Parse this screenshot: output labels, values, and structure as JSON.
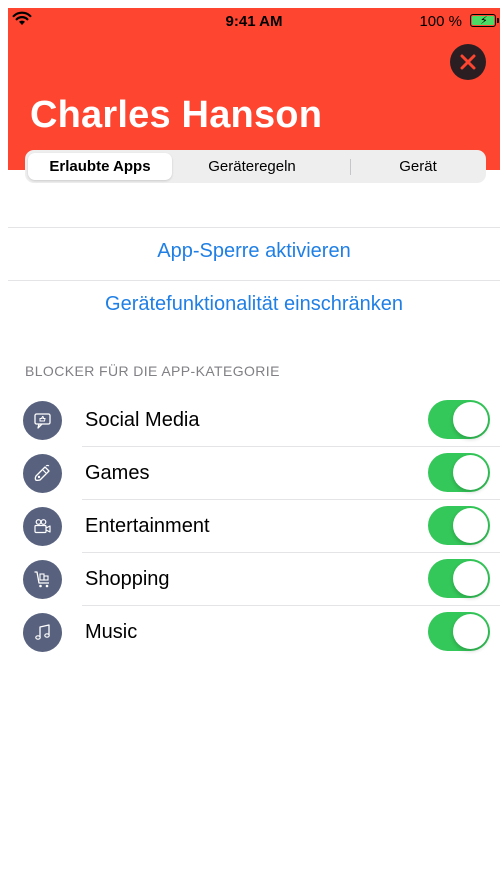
{
  "status_bar": {
    "time": "9:41 AM",
    "battery_percent": "100 %"
  },
  "header": {
    "title": "Charles Hanson",
    "background_color": "#fe4530"
  },
  "tabs": [
    {
      "label": "Erlaubte Apps",
      "selected": true
    },
    {
      "label": "Geräteregeln",
      "selected": false
    },
    {
      "label": "Gerät",
      "selected": false
    }
  ],
  "actions": {
    "app_lock": "App-Sperre aktivieren",
    "restrict_device": "Gerätefunktionalität einschränken"
  },
  "category_section": {
    "title": "BLOCKER FÜR DIE APP-KATEGORIE",
    "items": [
      {
        "label": "Social Media",
        "icon": "social-media-icon",
        "enabled": true
      },
      {
        "label": "Games",
        "icon": "gamepad-icon",
        "enabled": true
      },
      {
        "label": "Entertainment",
        "icon": "video-camera-icon",
        "enabled": true
      },
      {
        "label": "Shopping",
        "icon": "shopping-cart-icon",
        "enabled": true
      },
      {
        "label": "Music",
        "icon": "music-note-icon",
        "enabled": true
      }
    ]
  },
  "colors": {
    "accent_link": "#1f7fe5",
    "toggle_on": "#34c759",
    "icon_background": "#58627e"
  }
}
